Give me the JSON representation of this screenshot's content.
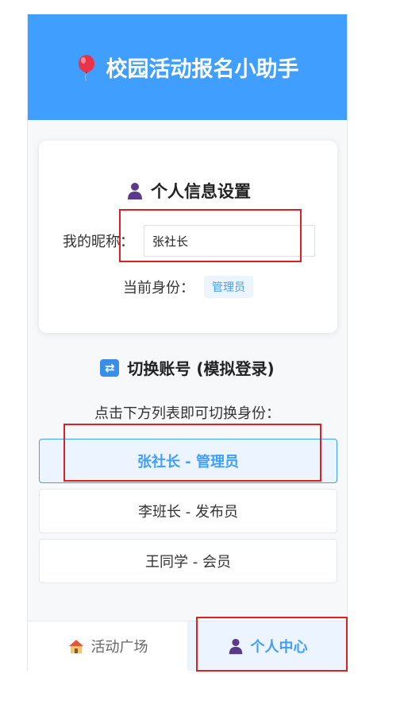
{
  "header": {
    "title": "校园活动报名小助手",
    "icon": "balloon-icon"
  },
  "profile": {
    "title": "个人信息设置",
    "icon": "person-icon",
    "nickname_label": "我的昵称：",
    "nickname_value": "张社长",
    "role_label": "当前身份：",
    "role_value": "管理员"
  },
  "switch": {
    "title": "切换账号 (模拟登录)",
    "icon": "switch-icon",
    "hint": "点击下方列表即可切换身份：",
    "accounts": [
      {
        "label": "张社长 - 管理员",
        "active": true
      },
      {
        "label": "李班长 - 发布员",
        "active": false
      },
      {
        "label": "王同学 - 会员",
        "active": false
      }
    ]
  },
  "tabs": [
    {
      "label": "活动广场",
      "icon": "house-icon",
      "active": false
    },
    {
      "label": "个人中心",
      "icon": "person-icon",
      "active": true
    }
  ],
  "colors": {
    "primary": "#409eff",
    "annotation": "#e02020"
  }
}
